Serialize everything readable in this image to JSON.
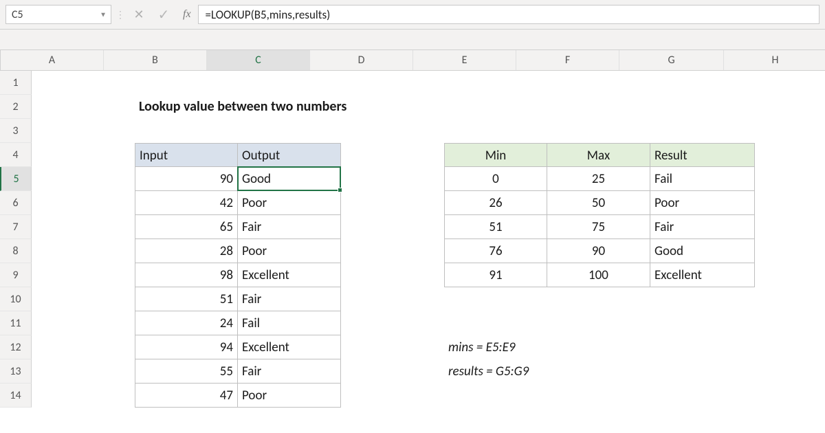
{
  "namebox": "C5",
  "fx_label": "fx",
  "formula": "=LOOKUP(B5,mins,results)",
  "columns": [
    "A",
    "B",
    "C",
    "D",
    "E",
    "F",
    "G",
    "H"
  ],
  "row_numbers": [
    "1",
    "2",
    "3",
    "4",
    "5",
    "6",
    "7",
    "8",
    "9",
    "10",
    "11",
    "12",
    "13",
    "14"
  ],
  "title": "Lookup value between two numbers",
  "io_headers": {
    "input": "Input",
    "output": "Output"
  },
  "io_rows": [
    {
      "input": "90",
      "output": "Good"
    },
    {
      "input": "42",
      "output": "Poor"
    },
    {
      "input": "65",
      "output": "Fair"
    },
    {
      "input": "28",
      "output": "Poor"
    },
    {
      "input": "98",
      "output": "Excellent"
    },
    {
      "input": "51",
      "output": "Fair"
    },
    {
      "input": "24",
      "output": "Fail"
    },
    {
      "input": "94",
      "output": "Excellent"
    },
    {
      "input": "55",
      "output": "Fair"
    },
    {
      "input": "47",
      "output": "Poor"
    }
  ],
  "lk_headers": {
    "min": "Min",
    "max": "Max",
    "result": "Result"
  },
  "lk_rows": [
    {
      "min": "0",
      "max": "25",
      "result": "Fail"
    },
    {
      "min": "26",
      "max": "50",
      "result": "Poor"
    },
    {
      "min": "51",
      "max": "75",
      "result": "Fair"
    },
    {
      "min": "76",
      "max": "90",
      "result": "Good"
    },
    {
      "min": "91",
      "max": "100",
      "result": "Excellent"
    }
  ],
  "notes": {
    "mins": "mins = E5:E9",
    "results": "results = G5:G9"
  },
  "active_cell": "C5"
}
